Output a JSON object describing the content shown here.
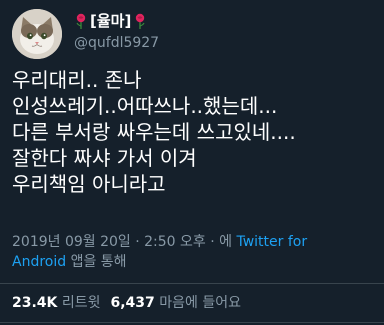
{
  "user": {
    "display_name": "[율마]",
    "handle": "@qufdl5927",
    "avatar": "cat-photo"
  },
  "decoration": {
    "left_icon": "rose-icon",
    "right_icon": "rose-icon",
    "rose_color": "#e0245e"
  },
  "tweet": {
    "lines": [
      "우리대리.. 존나",
      "인성쓰레기..어따쓰나..했는데...",
      "다른 부서랑 싸우는데 쓰고있네....",
      "잘한다 짜샤 가서 이겨",
      "우리책임 아니라고"
    ]
  },
  "meta": {
    "timestamp": "2019년 09월 20일 · 2:50 오후 · 에 ",
    "source_part1": "Twitter for",
    "source_part2": "Android",
    "suffix": " 앱을 통해"
  },
  "stats": {
    "retweets_count": "23.4K",
    "retweets_label": "리트윗",
    "likes_count": "6,437",
    "likes_label": "마음에 들어요"
  },
  "colors": {
    "background": "#15202b",
    "secondary_text": "#8899a6",
    "link": "#1da1f2"
  }
}
